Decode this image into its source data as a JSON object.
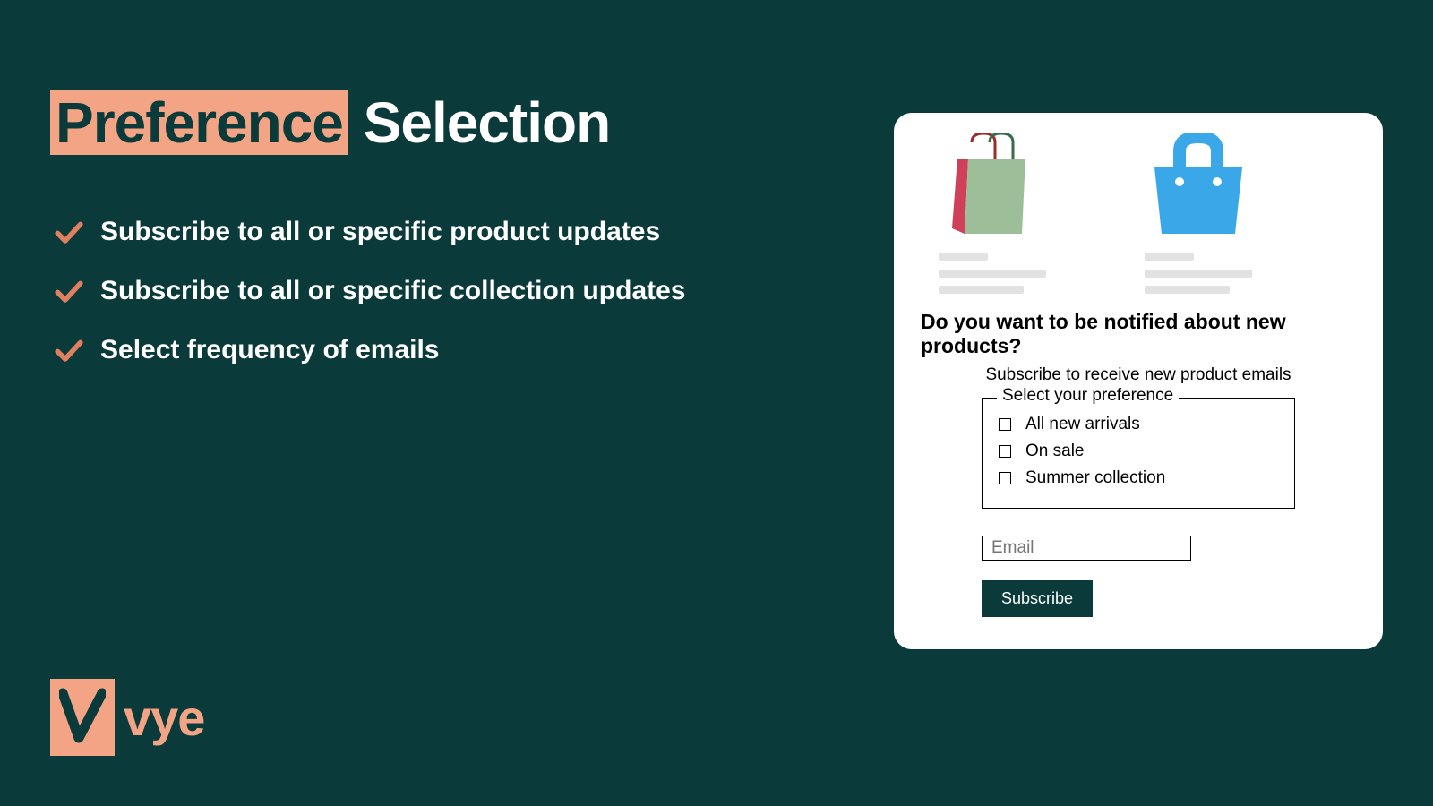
{
  "heading": {
    "highlight": "Preference",
    "rest": " Selection"
  },
  "bullets": [
    "Subscribe to all or specific product updates",
    "Subscribe to all or specific collection updates",
    "Select frequency of emails"
  ],
  "logo": {
    "text": "vye"
  },
  "card": {
    "title": "Do you want to be notified about new products?",
    "subtitle": "Subscribe to receive new product emails",
    "legend": "Select your preference",
    "options": [
      "All new arrivals",
      "On sale",
      "Summer collection"
    ],
    "email_placeholder": "Email",
    "subscribe_label": "Subscribe"
  }
}
